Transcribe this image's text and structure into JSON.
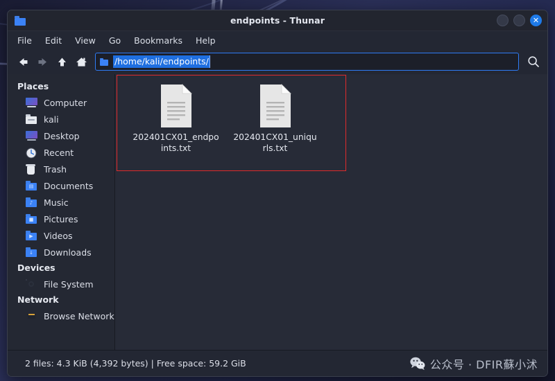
{
  "window": {
    "title": "endpoints - Thunar",
    "folder_icon": "folder-icon",
    "buttons": {
      "minimize": "minimize-button",
      "maximize": "maximize-button",
      "close_glyph": "✕"
    }
  },
  "menubar": {
    "items": [
      {
        "label": "File"
      },
      {
        "label": "Edit"
      },
      {
        "label": "View"
      },
      {
        "label": "Go"
      },
      {
        "label": "Bookmarks"
      },
      {
        "label": "Help"
      }
    ]
  },
  "toolbar": {
    "back": "back-icon",
    "forward": "forward-icon",
    "up": "up-icon",
    "home": "home-icon",
    "search": "search-icon",
    "path": {
      "value": "/home/kali/endpoints/",
      "placeholder": "Location",
      "selected": true,
      "selection_color": "#1f6fe0",
      "focus_border_color": "#2e7cf6"
    }
  },
  "sidebar": {
    "sections": [
      {
        "heading": "Places",
        "items": [
          {
            "label": "Computer",
            "icon": "computer-icon"
          },
          {
            "label": "kali",
            "icon": "home-folder-icon"
          },
          {
            "label": "Desktop",
            "icon": "desktop-folder-icon"
          },
          {
            "label": "Recent",
            "icon": "clock-icon"
          },
          {
            "label": "Trash",
            "icon": "trash-icon"
          },
          {
            "label": "Documents",
            "icon": "documents-folder-icon"
          },
          {
            "label": "Music",
            "icon": "music-folder-icon"
          },
          {
            "label": "Pictures",
            "icon": "pictures-folder-icon"
          },
          {
            "label": "Videos",
            "icon": "videos-folder-icon"
          },
          {
            "label": "Downloads",
            "icon": "downloads-folder-icon"
          }
        ]
      },
      {
        "heading": "Devices",
        "items": [
          {
            "label": "File System",
            "icon": "harddisk-icon"
          }
        ]
      },
      {
        "heading": "Network",
        "items": [
          {
            "label": "Browse Network",
            "icon": "network-icon"
          }
        ]
      }
    ]
  },
  "content": {
    "files": [
      {
        "name": "202401CX01_endpoints.txt",
        "icon": "text-file-icon"
      },
      {
        "name": "202401CX01_uniqurls.txt",
        "icon": "text-file-icon"
      }
    ],
    "annotation": {
      "shape": "rectangle",
      "color": "#e02b2b"
    }
  },
  "statusbar": {
    "text": "2 files: 4.3 KiB (4,392 bytes) | Free space: 59.2 GiB",
    "watermark": {
      "icon": "wechat-icon",
      "text": "公众号 · DFIR蘇小沭"
    }
  },
  "colors": {
    "accent": "#2e7cf6",
    "window_bg": "#232733",
    "content_bg": "#272b37",
    "sidebar_bg": "#242833",
    "annotation": "#e02b2b"
  }
}
